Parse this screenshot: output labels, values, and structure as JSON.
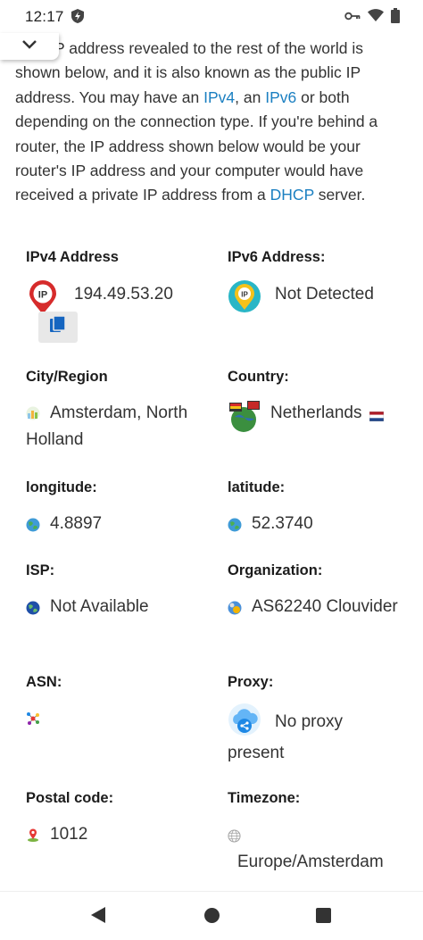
{
  "status_bar": {
    "time": "12:17"
  },
  "intro": {
    "line1": "P address revealed to the rest of the world is shown below, and it is also known as the public IP address. You may have an ",
    "link_ipv4": "IPv4",
    "mid1": ", an ",
    "link_ipv6": "IPv6",
    "mid2": " or both depending on the connection type. If you're behind a router, the IP address shown below would be your router's IP address and your computer would have received a private IP address from a ",
    "link_dhcp": "DHCP",
    "end": " server."
  },
  "fields": {
    "ipv4": {
      "label": "IPv4 Address",
      "value": "194.49.53.20"
    },
    "ipv6": {
      "label": "IPv6 Address:",
      "value": "Not Detected"
    },
    "city": {
      "label": "City/Region",
      "value": "Amsterdam, North Holland"
    },
    "country": {
      "label": "Country:",
      "value": "Netherlands"
    },
    "longitude": {
      "label": "longitude:",
      "value": "4.8897"
    },
    "latitude": {
      "label": "latitude:",
      "value": "52.3740"
    },
    "isp": {
      "label": "ISP:",
      "value": "Not Available"
    },
    "organization": {
      "label": "Organization:",
      "value": "AS62240 Clouvider"
    },
    "asn": {
      "label": "ASN:",
      "value": ""
    },
    "proxy": {
      "label": "Proxy:",
      "value": "No proxy present"
    },
    "postal": {
      "label": "Postal code:",
      "value": "1012"
    },
    "timezone": {
      "label": "Timezone:",
      "value": "Europe/Amsterdam"
    }
  },
  "icons": {
    "ipv4": "ip-pin-icon",
    "ipv6": "ip-pin-icon",
    "city": "city-icon",
    "country": "globe-flags-icon",
    "longitude": "globe-icon",
    "latitude": "globe-icon",
    "isp": "globe-icon",
    "organization": "organization-icon",
    "asn": "network-icon",
    "proxy": "cloud-share-icon",
    "postal": "map-pin-icon",
    "timezone": "world-icon",
    "copy": "copy-icon",
    "collapse": "chevron-down-icon"
  },
  "colors": {
    "link": "#1a7fc1",
    "ip_red": "#d62b2b",
    "ip_yellow": "#f4c21a",
    "copy_blue": "#1565c0"
  }
}
